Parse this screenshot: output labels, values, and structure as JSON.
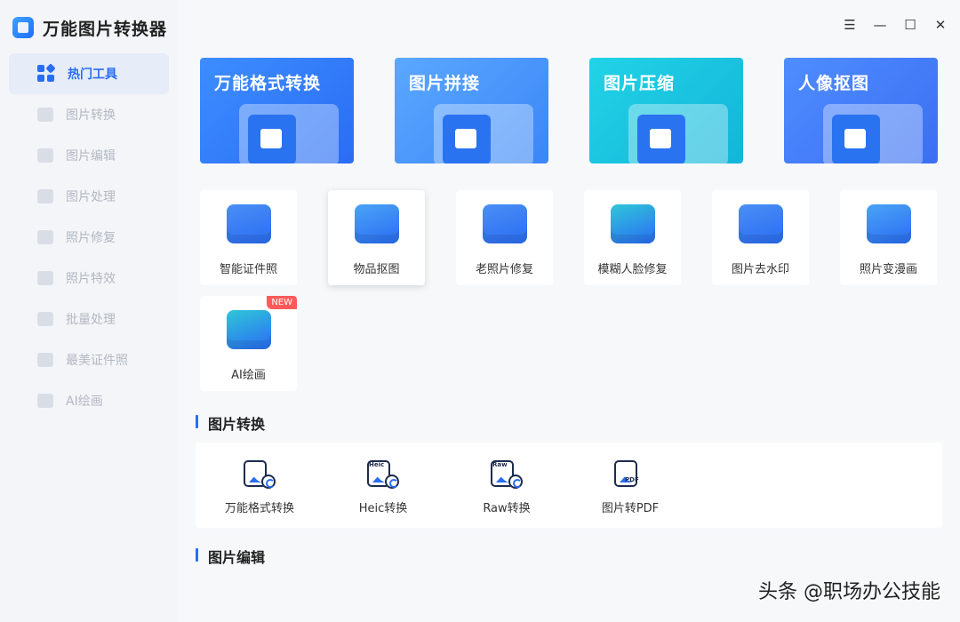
{
  "app": {
    "title": "万能图片转换器"
  },
  "sidebar": {
    "items": [
      {
        "label": "热门工具",
        "active": true
      },
      {
        "label": "图片转换"
      },
      {
        "label": "图片编辑"
      },
      {
        "label": "图片处理"
      },
      {
        "label": "照片修复"
      },
      {
        "label": "照片特效"
      },
      {
        "label": "批量处理"
      },
      {
        "label": "最美证件照"
      },
      {
        "label": "AI绘画"
      }
    ]
  },
  "window_controls": {
    "menu": "☰",
    "minimize": "—",
    "maximize": "☐",
    "close": "✕"
  },
  "banners": [
    {
      "label": "万能格式转换",
      "color_from": "#3d8dff",
      "color_to": "#2a6df4"
    },
    {
      "label": "图片拼接",
      "color_from": "#5aa8ff",
      "color_to": "#3b86f7"
    },
    {
      "label": "图片压缩",
      "color_from": "#22d3e6",
      "color_to": "#13b5d9"
    },
    {
      "label": "人像抠图",
      "color_from": "#4f8dff",
      "color_to": "#3b6ff2"
    }
  ],
  "tools": [
    {
      "label": "智能证件照",
      "color": "#4a8ff5"
    },
    {
      "label": "物品抠图",
      "color": "#4aa3f5"
    },
    {
      "label": "老照片修复",
      "color": "#4a8ff5"
    },
    {
      "label": "模糊人脸修复",
      "color": "#2fc6d8"
    },
    {
      "label": "图片去水印",
      "color": "#4a8ff5"
    },
    {
      "label": "照片变漫画",
      "color": "#4aa3f5"
    },
    {
      "label": "AI绘画",
      "color": "#2fc6d8",
      "badge": "NEW"
    }
  ],
  "sections": {
    "conversion": {
      "title": "图片转换"
    },
    "editing": {
      "title": "图片编辑"
    }
  },
  "conversions": [
    {
      "label": "万能格式转换",
      "tag": ""
    },
    {
      "label": "Heic转换",
      "tag": "Heic"
    },
    {
      "label": "Raw转换",
      "tag": "Raw"
    },
    {
      "label": "图片转PDF",
      "tag": "PDF"
    }
  ],
  "watermark": "头条 @职场办公技能"
}
